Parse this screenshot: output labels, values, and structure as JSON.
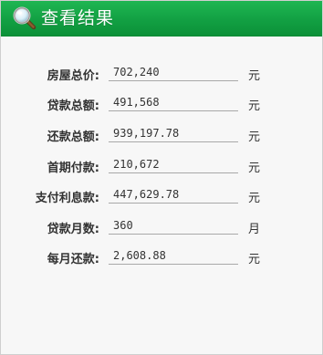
{
  "header": {
    "title": "查看结果",
    "icon": "magnifier-icon"
  },
  "rows": [
    {
      "label": "房屋总价:",
      "value": "702,240",
      "unit": "元"
    },
    {
      "label": "贷款总额:",
      "value": "491,568",
      "unit": "元"
    },
    {
      "label": "还款总额:",
      "value": "939,197.78",
      "unit": "元"
    },
    {
      "label": "首期付款:",
      "value": "210,672",
      "unit": "元"
    },
    {
      "label": "支付利息款:",
      "value": "447,629.78",
      "unit": "元"
    },
    {
      "label": "贷款月数:",
      "value": "360",
      "unit": "月"
    },
    {
      "label": "每月还款:",
      "value": "2,608.88",
      "unit": "元"
    }
  ],
  "colors": {
    "header_green": "#12a043",
    "panel_bg": "#f7f7f7"
  }
}
